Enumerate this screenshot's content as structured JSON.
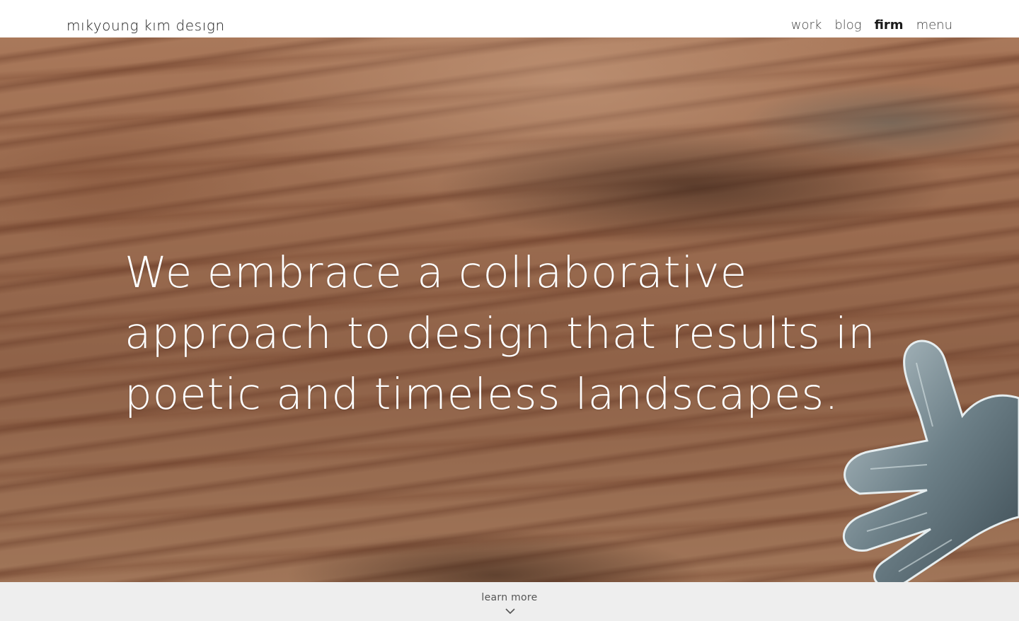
{
  "header": {
    "logo_text": "mıkyoung kım desıgn",
    "nav": [
      {
        "label": "work",
        "active": false
      },
      {
        "label": "blog",
        "active": false
      },
      {
        "label": "firm",
        "active": true
      },
      {
        "label": "menu",
        "active": false
      }
    ]
  },
  "hero": {
    "headline": "We embrace a collaborative approach to design that results in poetic and timeless landscapes.",
    "background_image": "wood-grain-with-hand-sculpture",
    "text_color": "#ffffff"
  },
  "footer_cta": {
    "label": "learn more",
    "icon": "chevron-down-icon",
    "background": "#eeeeee"
  }
}
